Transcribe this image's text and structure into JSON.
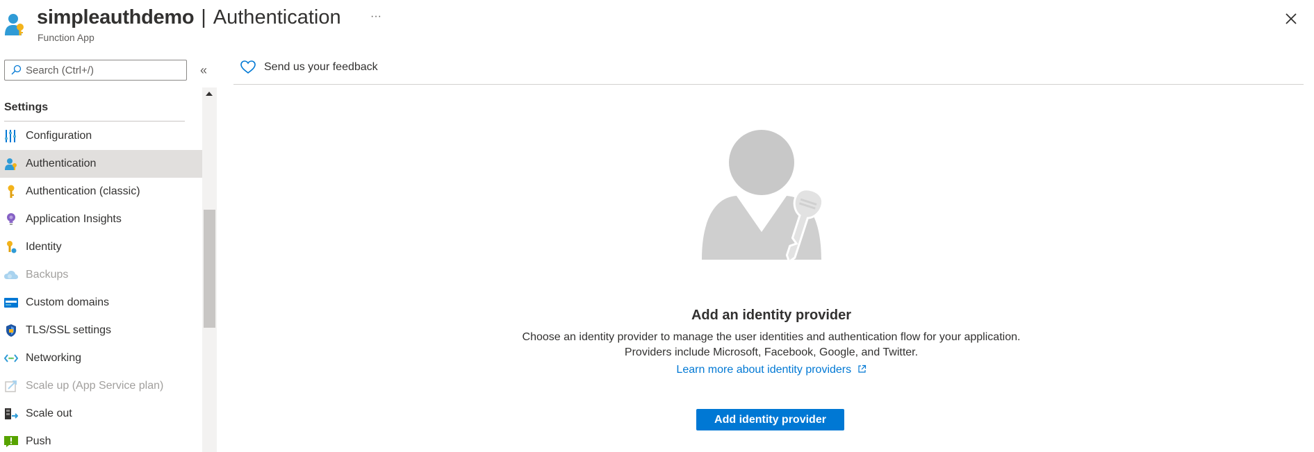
{
  "header": {
    "resource_name": "simpleauthdemo",
    "separator": "|",
    "page_title": "Authentication",
    "more_label": "···",
    "resource_type": "Function App",
    "app_icon": "user-key-icon",
    "close_icon": "close-icon"
  },
  "sidebar": {
    "search_placeholder": "Search (Ctrl+/)",
    "collapse_label": "«",
    "section": "Settings",
    "items": [
      {
        "label": "Configuration",
        "icon": "configuration-icon",
        "selected": false,
        "disabled": false
      },
      {
        "label": "Authentication",
        "icon": "authentication-icon",
        "selected": true,
        "disabled": false
      },
      {
        "label": "Authentication (classic)",
        "icon": "key-icon",
        "selected": false,
        "disabled": false
      },
      {
        "label": "Application Insights",
        "icon": "lightbulb-icon",
        "selected": false,
        "disabled": false
      },
      {
        "label": "Identity",
        "icon": "identity-icon",
        "selected": false,
        "disabled": false
      },
      {
        "label": "Backups",
        "icon": "cloud-backup-icon",
        "selected": false,
        "disabled": true
      },
      {
        "label": "Custom domains",
        "icon": "custom-domains-icon",
        "selected": false,
        "disabled": false
      },
      {
        "label": "TLS/SSL settings",
        "icon": "shield-icon",
        "selected": false,
        "disabled": false
      },
      {
        "label": "Networking",
        "icon": "networking-icon",
        "selected": false,
        "disabled": false
      },
      {
        "label": "Scale up (App Service plan)",
        "icon": "scale-up-icon",
        "selected": false,
        "disabled": true
      },
      {
        "label": "Scale out",
        "icon": "scale-out-icon",
        "selected": false,
        "disabled": false
      },
      {
        "label": "Push",
        "icon": "push-icon",
        "selected": false,
        "disabled": false
      }
    ]
  },
  "main": {
    "feedback_label": "Send us your feedback",
    "empty_title": "Add an identity provider",
    "empty_desc_line1": "Choose an identity provider to manage the user identities and authentication flow for your application.",
    "empty_desc_line2": "Providers include Microsoft, Facebook, Google, and Twitter.",
    "learn_more_link": "Learn more about identity providers",
    "add_button_label": "Add identity provider"
  },
  "colors": {
    "accent": "#0078d4",
    "selected_bg": "#e1dfdd",
    "text": "#323130",
    "muted_text": "#a19f9d"
  }
}
